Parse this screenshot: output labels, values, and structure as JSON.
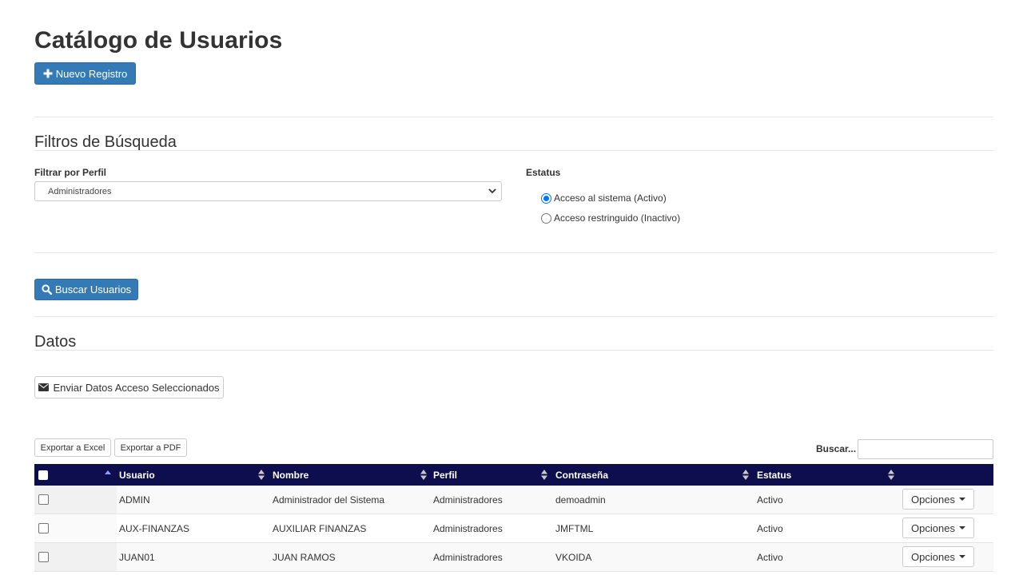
{
  "page": {
    "title": "Catálogo de Usuarios",
    "new_button": "Nuevo Registro"
  },
  "filters": {
    "section_title": "Filtros de Búsqueda",
    "profile_label": "Filtrar por Perfil",
    "profile_selected": "Administradores",
    "status_label": "Estatus",
    "status_options": [
      {
        "label": "Acceso al sistema (Activo)",
        "checked": true
      },
      {
        "label": "Acceso restringuido (Inactivo)",
        "checked": false
      }
    ],
    "search_button": "Buscar Usuarios"
  },
  "data_section": {
    "title": "Datos",
    "send_button": "Enviar Datos Acceso Seleccionados",
    "export_excel": "Exportar a Excel",
    "export_pdf": "Exportar a PDF",
    "search_label": "Buscar..."
  },
  "table": {
    "columns": [
      "Usuario",
      "Nombre",
      "Perfil",
      "Contraseña",
      "Estatus"
    ],
    "options_label": "Opciones",
    "rows": [
      {
        "usuario": "ADMIN",
        "nombre": "Administrador del Sistema",
        "perfil": "Administradores",
        "contrasena": "demoadmin",
        "estatus": "Activo"
      },
      {
        "usuario": "AUX-FINANZAS",
        "nombre": "AUXILIAR FINANZAS",
        "perfil": "Administradores",
        "contrasena": "JMFTML",
        "estatus": "Activo"
      },
      {
        "usuario": "JUAN01",
        "nombre": "JUAN RAMOS",
        "perfil": "Administradores",
        "contrasena": "VKOIDA",
        "estatus": "Activo"
      }
    ]
  },
  "colors": {
    "primary": "#337ab7",
    "table_header": "#0e0e4e",
    "radio_accent": "#0075ff"
  },
  "icons": {
    "new": "plus-icon",
    "search": "search-icon",
    "send": "envelope-icon",
    "select": "chevron-down-icon",
    "sort": "sort-icon",
    "options": "caret-down-icon"
  }
}
